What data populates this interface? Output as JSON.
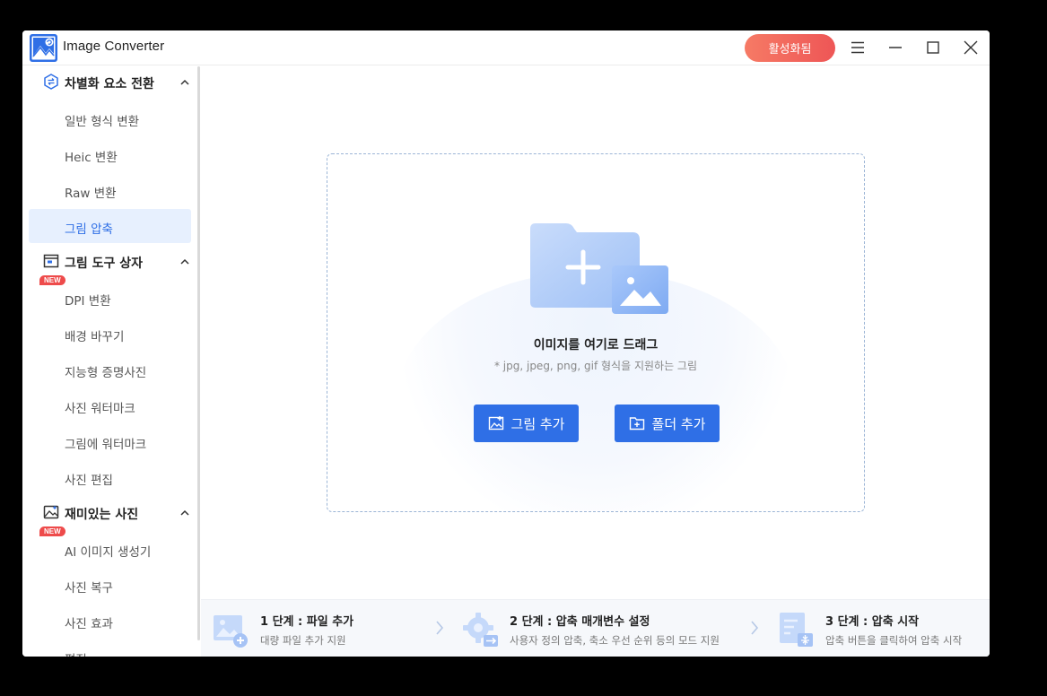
{
  "app": {
    "title": "Image Converter",
    "activate_label": "활성화됨"
  },
  "window_controls": [
    "menu-icon",
    "minimize-icon",
    "maximize-icon",
    "close-icon"
  ],
  "sidebar": {
    "sections": [
      {
        "label": "차별화 요소 전환",
        "icon": "convert-icon",
        "items": [
          {
            "label": "일반 형식 변환"
          },
          {
            "label": "Heic 변환"
          },
          {
            "label": "Raw 변환"
          },
          {
            "label": "그림 압축",
            "active": true
          }
        ]
      },
      {
        "label": "그림 도구 상자",
        "icon": "toolbox-icon",
        "items": [
          {
            "label": "DPI 변환",
            "badge": "NEW"
          },
          {
            "label": "배경 바꾸기"
          },
          {
            "label": "지능형 증명사진"
          },
          {
            "label": "사진 워터마크"
          },
          {
            "label": "그림에 워터마크"
          },
          {
            "label": "사진 편집"
          }
        ]
      },
      {
        "label": "재미있는 사진",
        "icon": "fun-photo-icon",
        "items": [
          {
            "label": "AI 이미지 생성기",
            "badge": "NEW"
          },
          {
            "label": "사진 복구"
          },
          {
            "label": "사진 효과"
          },
          {
            "label": "편집"
          }
        ]
      }
    ]
  },
  "dropzone": {
    "title": "이미지를 여기로 드래그",
    "subtitle": "* jpg, jpeg, png, gif 형식을 지원하는 그림",
    "add_image_label": "그림 추가",
    "add_folder_label": "폴더 추가"
  },
  "steps": [
    {
      "title": "1 단계 : 파일 추가",
      "desc": "대량 파일 추가 지원"
    },
    {
      "title": "2 단계 : 압축 매개변수 설정",
      "desc": "사용자 정의 압축, 축소 우선 순위 등의 모드 지원"
    },
    {
      "title": "3 단계 : 압축 시작",
      "desc": "압축 버튼을 클릭하여 압축 시작"
    }
  ],
  "colors": {
    "accent": "#2f6fe6",
    "activate_start": "#f67a65",
    "activate_end": "#ee5656",
    "badge": "#ee4b4b"
  }
}
